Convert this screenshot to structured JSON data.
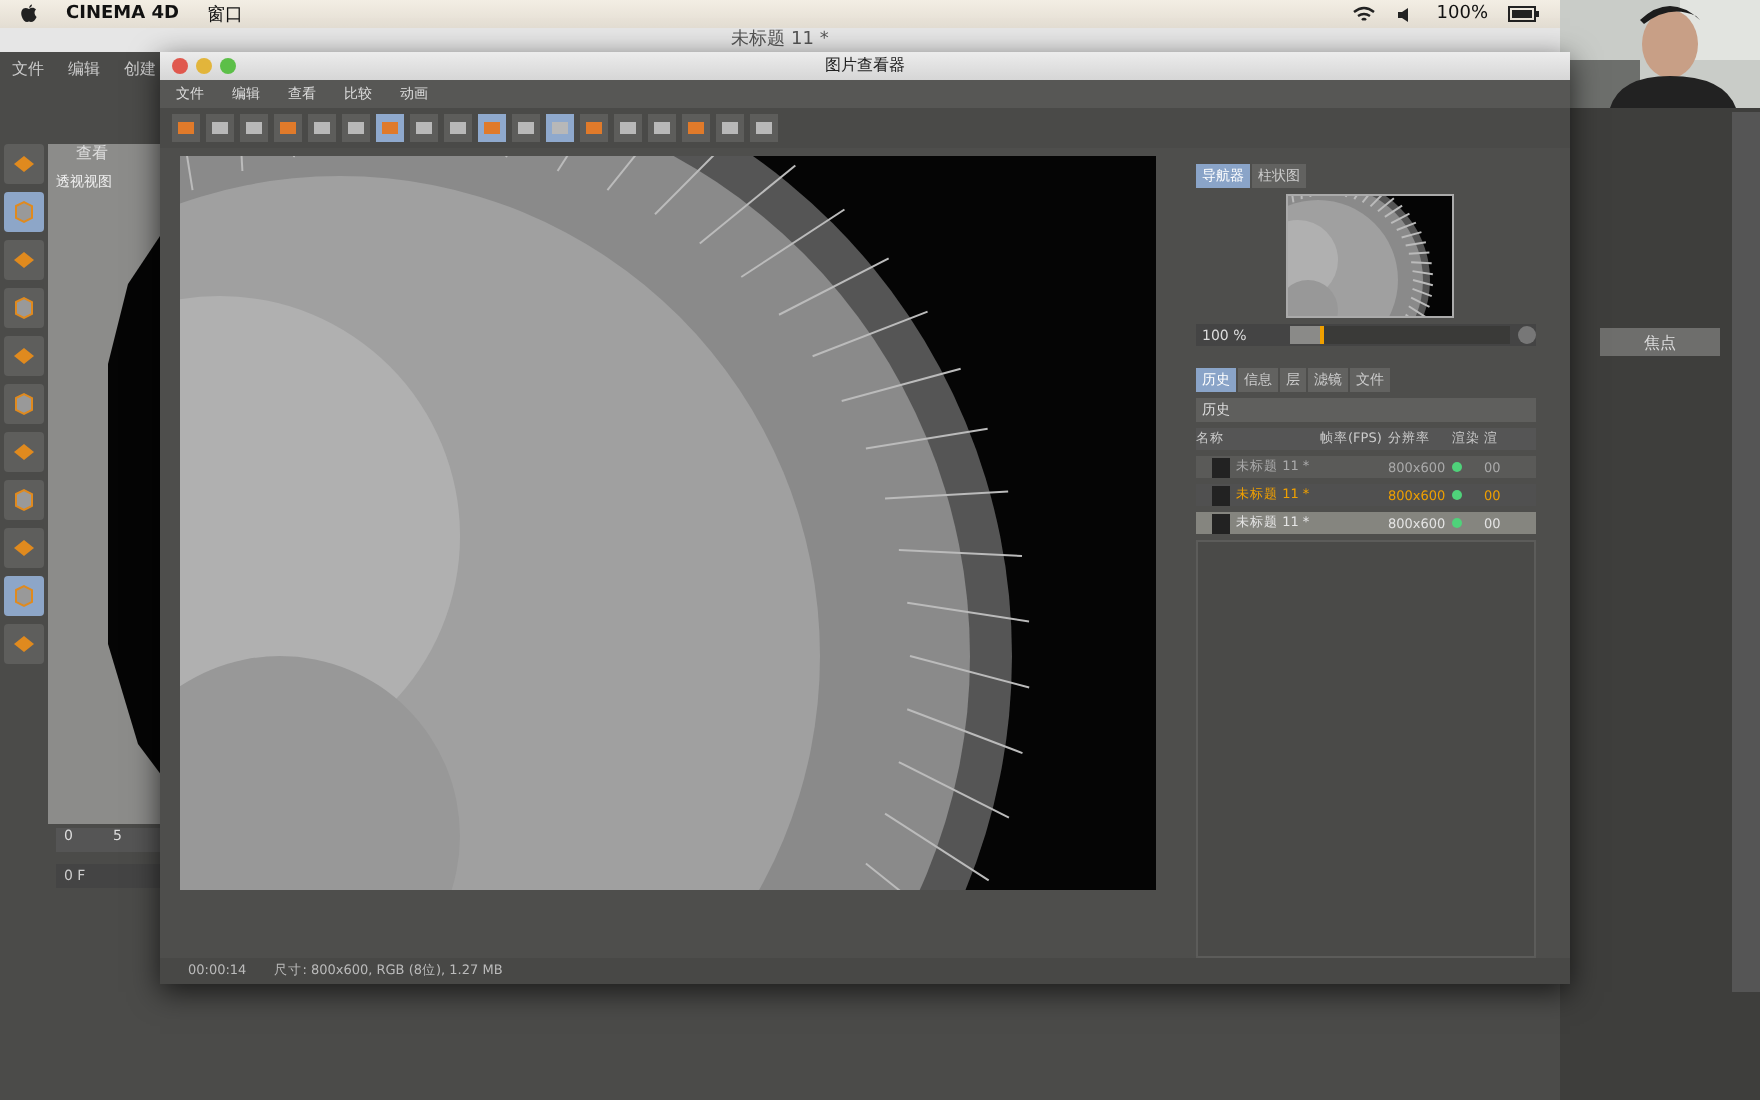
{
  "menubar": {
    "app": "CINEMA 4D",
    "items": [
      "窗口"
    ],
    "battery": "100%"
  },
  "main_window": {
    "title": "未标题 11 *",
    "menus": [
      "文件",
      "编辑",
      "创建"
    ],
    "viewport_menu": "查看",
    "viewport_label": "透视视图",
    "tools": [
      {
        "on": false
      },
      {
        "on": true
      },
      {
        "on": false
      },
      {
        "on": false
      },
      {
        "on": false
      },
      {
        "on": false
      },
      {
        "on": false
      },
      {
        "on": false
      },
      {
        "on": false
      },
      {
        "on": true
      },
      {
        "on": false
      }
    ],
    "timeline": [
      "0",
      "5"
    ],
    "frame": "0 F",
    "attr_button": "焦点"
  },
  "viewer": {
    "title": "图片查看器",
    "menus": [
      "文件",
      "编辑",
      "查看",
      "比较",
      "动画"
    ],
    "toolbar": [
      {
        "on": false
      },
      {
        "on": false
      },
      {
        "on": false
      },
      {
        "on": false
      },
      {
        "on": false
      },
      {
        "on": false
      },
      {
        "on": true
      },
      {
        "on": false
      },
      {
        "on": false
      },
      {
        "on": true
      },
      {
        "on": false
      },
      {
        "on": true
      },
      {
        "on": false
      },
      {
        "on": false
      },
      {
        "on": false
      },
      {
        "on": false
      },
      {
        "on": false
      },
      {
        "on": false
      }
    ],
    "nav_tabs": [
      {
        "label": "导航器",
        "selected": true
      },
      {
        "label": "柱状图",
        "selected": false
      }
    ],
    "zoom": {
      "reading": "100 %",
      "level": 0.15
    },
    "tabs": [
      {
        "label": "历史",
        "selected": true
      },
      {
        "label": "信息",
        "selected": false
      },
      {
        "label": "层",
        "selected": false
      },
      {
        "label": "滤镜",
        "selected": false
      },
      {
        "label": "文件",
        "selected": false
      }
    ],
    "history_title": "历史",
    "columns": [
      "名称",
      "帧率(FPS)",
      "分辨率",
      "渲染",
      "渲"
    ],
    "rows": [
      {
        "name": "未标题 11 *",
        "resolution": "800x600",
        "rendered": true,
        "column_5": "00",
        "selected": false,
        "highlighted": false
      },
      {
        "name": "未标题 11 *",
        "resolution": "800x600",
        "rendered": true,
        "column_5": "00",
        "selected": true,
        "highlighted": false
      },
      {
        "name": "未标题 11 *",
        "resolution": "800x600",
        "rendered": true,
        "column_5": "00",
        "selected": false,
        "highlighted": true
      }
    ],
    "status": {
      "time": "00:00:14",
      "info": "尺寸: 800x600, RGB (8位), 1.27 MB"
    }
  }
}
